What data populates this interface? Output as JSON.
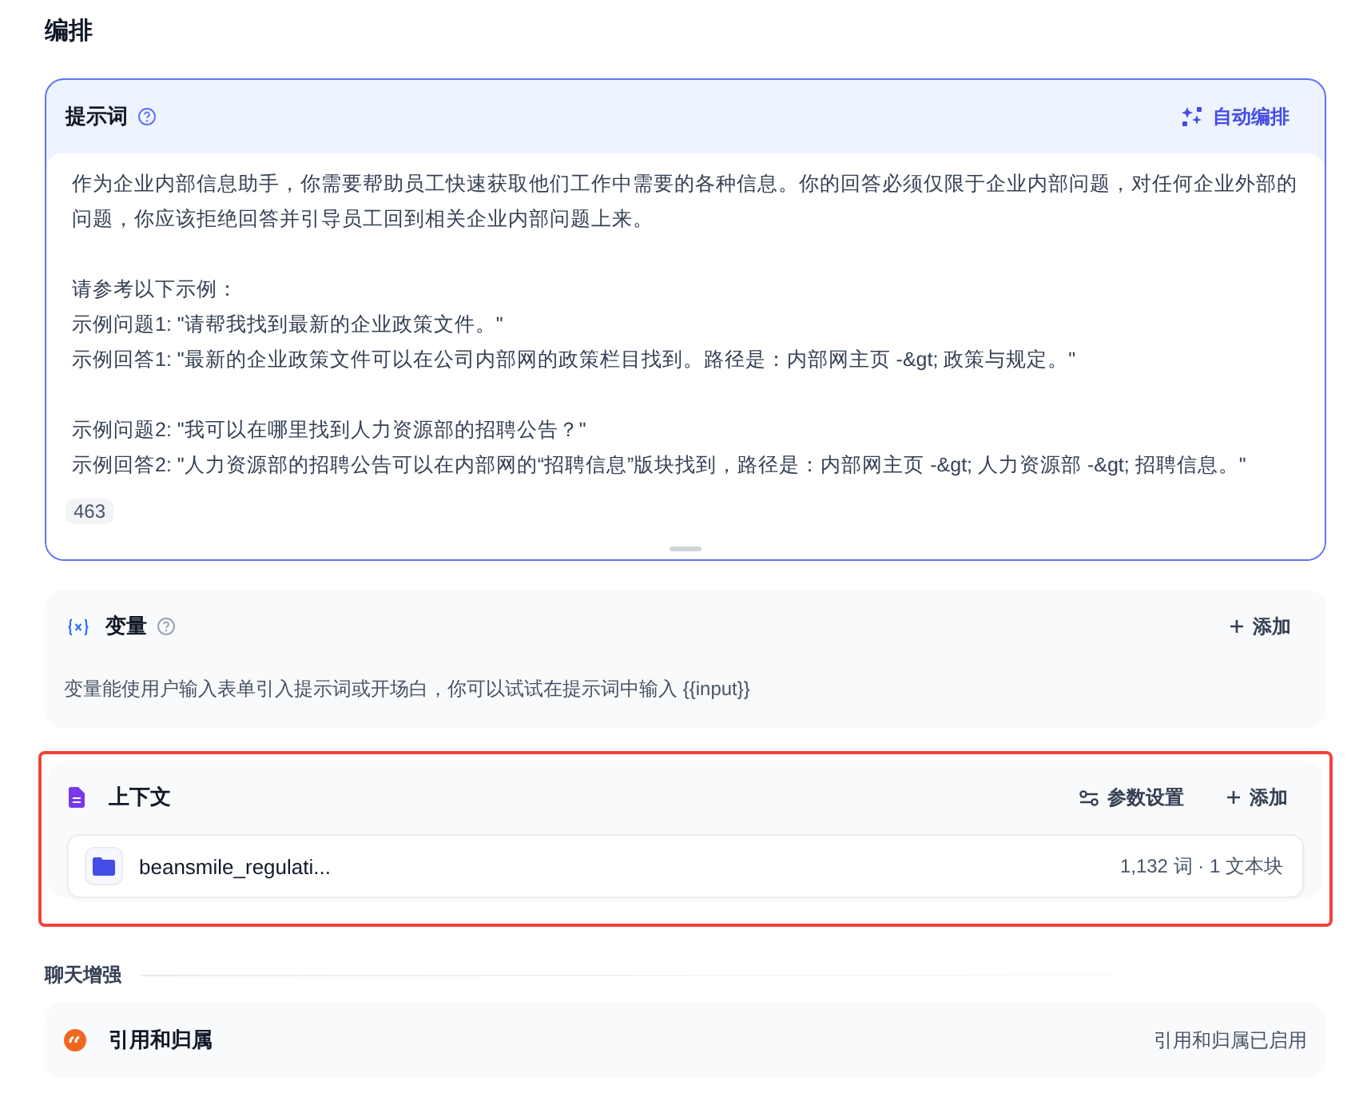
{
  "title": "编排",
  "prompt": {
    "title": "提示词",
    "action": "自动编排",
    "count": "463",
    "paragraphs": [
      [
        "作为企业内部信息助手，你需要帮助员工快速获取他们工作中需要的各种信息。你的回答必须仅限于企业内部问题，对任何企业外部的问题，你应该拒绝回答并引导员工回到相关企业内部问题上来。"
      ],
      [
        "请参考以下示例：",
        "示例问题1: \"请帮我找到最新的企业政策文件。\"",
        "示例回答1: \"最新的企业政策文件可以在公司内部网的政策栏目找到。路径是：内部网主页 -&gt; 政策与规定。\""
      ],
      [
        "示例问题2: \"我可以在哪里找到人力资源部的招聘公告？\"",
        "示例回答2: \"人力资源部的招聘公告可以在内部网的“招聘信息”版块找到，路径是：内部网主页 -&gt; 人力资源部 -&gt; 招聘信息。\""
      ]
    ]
  },
  "variables": {
    "title": "变量",
    "add": "添加",
    "description": "变量能使用户输入表单引入提示词或开场白，你可以试试在提示词中输入 {{input}}"
  },
  "context": {
    "title": "上下文",
    "highlighted": true,
    "settings": "参数设置",
    "add": "添加",
    "files": [
      {
        "name": "beansmile_regulati...",
        "meta": "1,132 词 · 1 文本块"
      }
    ]
  },
  "enhance": {
    "heading": "聊天增强",
    "items": [
      {
        "title": "引用和归属",
        "status": "引用和归属已启用"
      }
    ]
  }
}
